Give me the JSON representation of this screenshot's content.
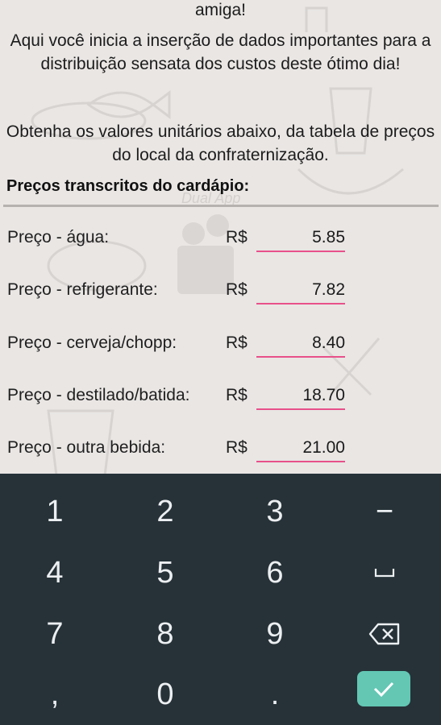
{
  "intro": {
    "line_top": "amiga!",
    "paragraph_2": "Aqui você inicia a inserção de dados importantes para a distribuição sensata dos custos deste ótimo dia!",
    "paragraph_3": "Obtenha os valores unitários abaixo, da tabela de preços do local da confraternização."
  },
  "section_title": "Preços transcritos do cardápio:",
  "watermark_text": "Dual App",
  "currency_symbol": "R$",
  "prices": [
    {
      "label": "Preço - água:",
      "value": "5.85"
    },
    {
      "label": "Preço - refrigerante:",
      "value": "7.82"
    },
    {
      "label": "Preço - cerveja/chopp:",
      "value": "8.40"
    },
    {
      "label": "Preço - destilado/batida:",
      "value": "18.70"
    },
    {
      "label": "Preço - outra bebida:",
      "value": "21.00"
    }
  ],
  "keyboard": {
    "row1": [
      "1",
      "2",
      "3",
      "−"
    ],
    "row2": [
      "4",
      "5",
      "6",
      "space-icon"
    ],
    "row3": [
      "7",
      "8",
      "9",
      "backspace-icon"
    ],
    "row4": [
      ",",
      "0",
      ".",
      "check-icon"
    ]
  },
  "colors": {
    "background": "#e9e6e4",
    "input_underline": "#e8508a",
    "keyboard_bg": "#263238",
    "key_text": "#eceff1",
    "enter_key": "#63c7b4"
  }
}
